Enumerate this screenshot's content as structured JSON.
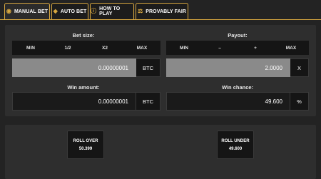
{
  "tabs": [
    {
      "label": "MANUAL BET",
      "icon": "coins-icon",
      "active": true
    },
    {
      "label": "AUTO BET",
      "icon": "diamond-icon",
      "active": false
    },
    {
      "label": "HOW TO PLAY",
      "icon": "info-icon",
      "active": false
    },
    {
      "label": "PROVABLY FAIR",
      "icon": "scales-icon",
      "active": false
    }
  ],
  "bet": {
    "label": "Bet size:",
    "controls": [
      "MIN",
      "1/2",
      "X2",
      "MAX"
    ],
    "value": "0.00000001",
    "unit": "BTC"
  },
  "payout": {
    "label": "Payout:",
    "controls": [
      "MIN",
      "–",
      "+",
      "MAX"
    ],
    "value": "2.0000",
    "unit": "X"
  },
  "win_amount": {
    "label": "Win amount:",
    "value": "0.00000001",
    "unit": "BTC"
  },
  "win_chance": {
    "label": "Win chance:",
    "value": "49.600",
    "unit": "%"
  },
  "roll_over": {
    "label": "ROLL OVER",
    "value": "50.399"
  },
  "roll_under": {
    "label": "ROLL UNDER",
    "value": "49.600"
  },
  "colors": {
    "accent": "#d7a740",
    "background": "#232323",
    "panel": "#2e2e2e"
  }
}
